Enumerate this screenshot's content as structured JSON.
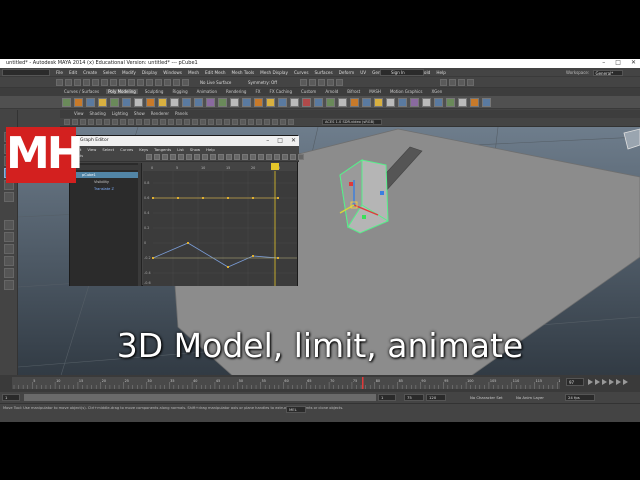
{
  "logo": {
    "text": "MH"
  },
  "caption": {
    "text": "3D Model, limit, animate"
  },
  "window": {
    "title": "untitled* - Autodesk MAYA 2014 (x) Educational Version: untitled* --- pCube1",
    "controls": [
      "–",
      "□",
      "✕"
    ]
  },
  "menubar": {
    "mode": "Modeling",
    "items": [
      "File",
      "Edit",
      "Create",
      "Select",
      "Modify",
      "Display",
      "Windows",
      "Mesh",
      "Edit Mesh",
      "Mesh Tools",
      "Mesh Display",
      "Curves",
      "Surfaces",
      "Deform",
      "UV",
      "Generate",
      "Cache",
      "Arnold",
      "Help"
    ],
    "signin": "Sign In",
    "workspace_label": "Workspace:",
    "workspace_value": "General*"
  },
  "statusline": {
    "live_surface": "No Live Surface",
    "symmetry": "Symmetry: Off"
  },
  "shelf": {
    "tabs": [
      "Curves / Surfaces",
      "Poly Modeling",
      "Sculpting",
      "Rigging",
      "Animation",
      "Rendering",
      "FX",
      "FX Caching",
      "Custom",
      "Arnold",
      "Bifrost",
      "MASH",
      "Motion Graphics",
      "XGen"
    ],
    "active_tab": "Poly Modeling"
  },
  "panel": {
    "menus": [
      "View",
      "Shading",
      "Lighting",
      "Show",
      "Renderer",
      "Panels"
    ],
    "camera_field": "ACES 1.0 SDR-video (sRGB)"
  },
  "graph_editor": {
    "title": "Graph Editor",
    "controls": [
      "–",
      "□",
      "✕"
    ],
    "menus": [
      "Edit",
      "View",
      "Select",
      "Curves",
      "Keys",
      "Tangents",
      "List",
      "Show",
      "Help"
    ],
    "stats_label": "Stats",
    "outliner": [
      {
        "label": "pCube1",
        "selected": true
      },
      {
        "label": "Visibility",
        "selected": false
      },
      {
        "label": "Translate Z",
        "selected": false
      }
    ],
    "y_ticks": [
      "0.8",
      "0.6",
      "0.4",
      "0.2",
      "0",
      "-0.2",
      "-0.4",
      "-0.6"
    ],
    "x_ticks": [
      "0",
      "5",
      "10",
      "15",
      "20",
      "25"
    ]
  },
  "timeslider": {
    "current_frame": "97",
    "ticks": [
      "5",
      "10",
      "15",
      "20",
      "25",
      "30",
      "35",
      "40",
      "45",
      "50",
      "55",
      "60",
      "65",
      "70",
      "75",
      "80",
      "85",
      "90",
      "95",
      "100",
      "105",
      "110",
      "115",
      "120"
    ]
  },
  "rangeslider": {
    "start": "1",
    "end": "120",
    "playback_start": "1",
    "playback_end": "75",
    "char_set": "No Character Set",
    "anim_layer": "No Anim Layer",
    "fps": "24 fps"
  },
  "helpline": {
    "text": "Move Tool: Use manipulator to move object(s). Ctrl+middle-drag to move components along normals. Shift+drag manipulator axis or plane handles to extrude components or clone objects.",
    "mel": "MEL"
  }
}
